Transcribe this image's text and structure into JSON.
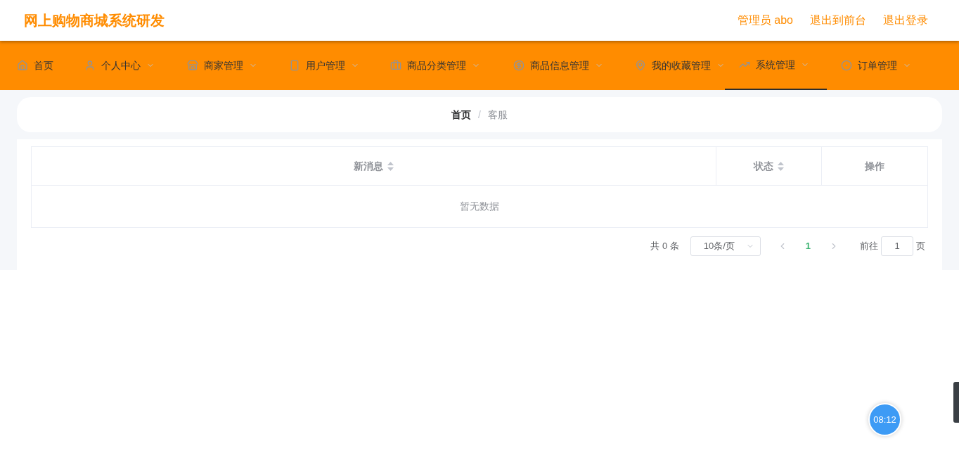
{
  "header": {
    "title": "网上购物商城系统研发",
    "links": [
      "管理员 abo",
      "退出到前台",
      "退出登录"
    ]
  },
  "nav": [
    {
      "label": "首页",
      "dropdown": false,
      "selected": false
    },
    {
      "label": "个人中心",
      "dropdown": true,
      "selected": false
    },
    {
      "label": "商家管理",
      "dropdown": true,
      "selected": false
    },
    {
      "label": "用户管理",
      "dropdown": true,
      "selected": false
    },
    {
      "label": "商品分类管理",
      "dropdown": true,
      "selected": false
    },
    {
      "label": "商品信息管理",
      "dropdown": true,
      "selected": false
    },
    {
      "label": "我的收藏管理",
      "dropdown": true,
      "selected": false
    },
    {
      "label": "系统管理",
      "dropdown": true,
      "selected": true
    },
    {
      "label": "订单管理",
      "dropdown": true,
      "selected": false
    }
  ],
  "breadcrumb": {
    "items": [
      "首页",
      "客服"
    ],
    "separator": "/"
  },
  "table": {
    "columns": [
      {
        "label": "新消息",
        "sortable": true
      },
      {
        "label": "状态",
        "sortable": true
      },
      {
        "label": "操作",
        "sortable": false
      }
    ],
    "empty_text": "暂无数据"
  },
  "pagination": {
    "total": "共 0 条",
    "page_size": "10条/页",
    "pages": [
      {
        "label": "1",
        "selected": true
      }
    ],
    "goto_label": "前往",
    "goto_value": "1",
    "goto_suffix": "页"
  },
  "timer": "08:12"
}
